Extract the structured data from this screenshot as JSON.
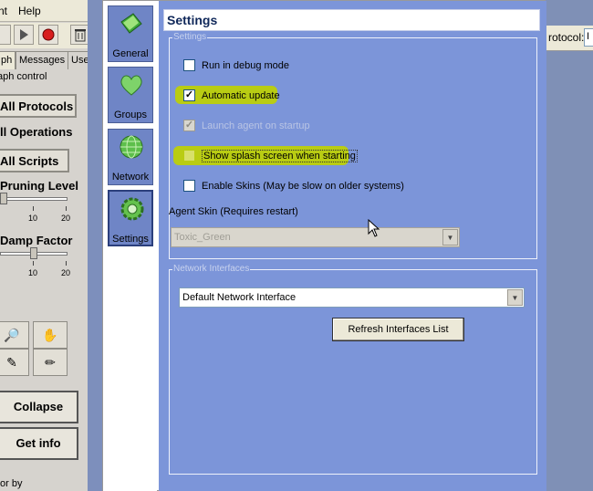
{
  "background_app": {
    "menu": [
      "nt",
      "Help"
    ],
    "tabs": [
      "ph",
      "Messages",
      "User S"
    ],
    "panel": {
      "header": "aph control",
      "buttons": [
        "All Protocols",
        "ll Operations",
        "All Scripts"
      ],
      "pruning_label": "Pruning Level",
      "damp_label": "Damp Factor",
      "tick_10": "10",
      "tick_20": "20",
      "collapse": "Collapse",
      "get_info": "Get info",
      "bottom_label": "or by"
    },
    "right_toolbar_label": "rotocol:",
    "right_combo_value": "I"
  },
  "dialog": {
    "nav": [
      {
        "label": "General",
        "icon": "book-icon"
      },
      {
        "label": "Groups",
        "icon": "heart-icon"
      },
      {
        "label": "Network",
        "icon": "globe-icon"
      },
      {
        "label": "Settings",
        "icon": "gear-icon",
        "active": true
      }
    ],
    "title": "Settings",
    "settings_group": {
      "title": "Settings",
      "options": [
        {
          "label": "Run in debug mode",
          "checked": false,
          "enabled": true,
          "highlighted": false
        },
        {
          "label": "Automatic update",
          "checked": true,
          "enabled": true,
          "highlighted": true
        },
        {
          "label": "Launch agent on startup",
          "checked": true,
          "enabled": false,
          "highlighted": false
        },
        {
          "label": "Show splash screen when starting",
          "checked": false,
          "enabled": true,
          "highlighted": true
        },
        {
          "label": "Enable Skins (May be slow on older systems)",
          "checked": false,
          "enabled": true,
          "highlighted": false
        }
      ],
      "skin_label": "Agent Skin (Requires restart)",
      "skin_value": "Toxic_Green"
    },
    "network_group": {
      "title": "Network Interfaces",
      "interface_value": "Default Network Interface",
      "refresh_label": "Refresh Interfaces List"
    }
  },
  "colors": {
    "dialog_bg": "#7c95d9",
    "highlight": "#b9cc13",
    "nav_bg": "#6f85c6"
  }
}
